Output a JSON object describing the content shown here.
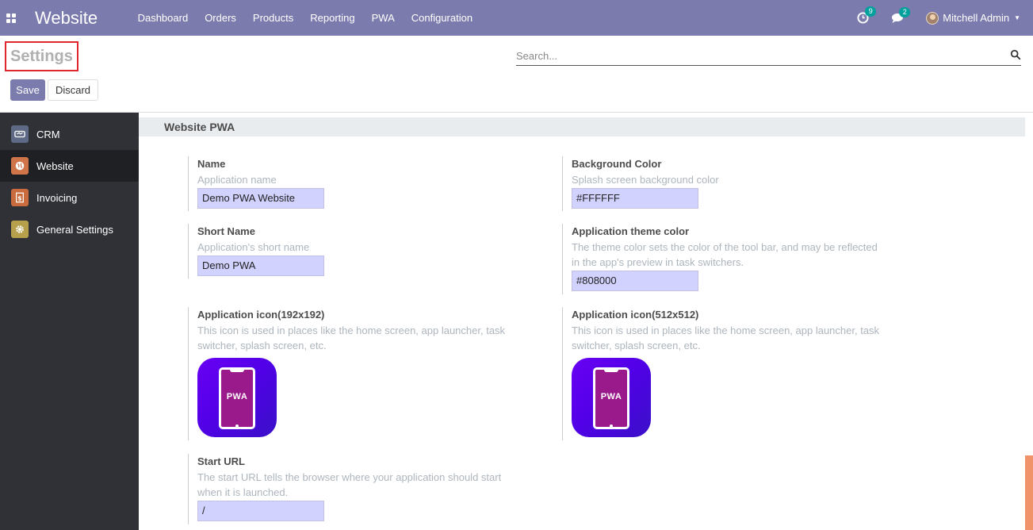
{
  "navbar": {
    "app_name": "Website",
    "menu": [
      "Dashboard",
      "Orders",
      "Products",
      "Reporting",
      "PWA",
      "Configuration"
    ],
    "activity_count": "9",
    "message_count": "2",
    "user_name": "Mitchell Admin"
  },
  "control_panel": {
    "title": "Settings",
    "search_placeholder": "Search...",
    "save_label": "Save",
    "discard_label": "Discard"
  },
  "sidebar": {
    "items": [
      {
        "label": "CRM",
        "color": "#5e6a85",
        "icon": "handshake-icon"
      },
      {
        "label": "Website",
        "color": "#d0744a",
        "icon": "globe-icon"
      },
      {
        "label": "Invoicing",
        "color": "#c96b3c",
        "icon": "invoice-icon"
      },
      {
        "label": "General Settings",
        "color": "#b7a04c",
        "icon": "gear-icon"
      }
    ],
    "active_index": 1
  },
  "section": {
    "title": "Website PWA"
  },
  "settings": {
    "name": {
      "label": "Name",
      "help": "Application name",
      "value": "Demo PWA Website"
    },
    "short_name": {
      "label": "Short Name",
      "help": "Application's short name",
      "value": "Demo PWA"
    },
    "icon_192": {
      "label": "Application icon(192x192)",
      "help": "This icon is used in places like the home screen, app launcher, task switcher, splash screen, etc.",
      "icon_text": "PWA"
    },
    "start_url": {
      "label": "Start URL",
      "help": "The start URL tells the browser where your application should start when it is launched.",
      "value": "/"
    },
    "background_color": {
      "label": "Background Color",
      "help": "Splash screen background color",
      "value": "#FFFFFF"
    },
    "theme_color": {
      "label": "Application theme color",
      "help": "The theme color sets the color of the tool bar, and may be reflected in the app's preview in task switchers.",
      "value": "#808000"
    },
    "icon_512": {
      "label": "Application icon(512x512)",
      "help": "This icon is used in places like the home screen, app launcher, task switcher, splash screen, etc.",
      "icon_text": "PWA"
    }
  },
  "colors": {
    "navbar": "#7c7bad",
    "input_bg": "#d2d2ff",
    "sidebar_bg": "#2f3136"
  }
}
